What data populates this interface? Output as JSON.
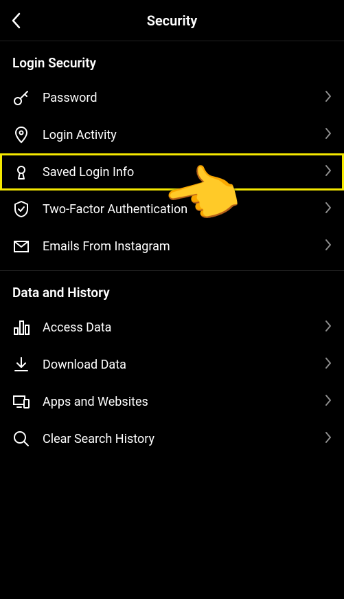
{
  "header": {
    "title": "Security"
  },
  "sections": {
    "login_security": {
      "title": "Login Security",
      "items": [
        {
          "label": "Password"
        },
        {
          "label": "Login Activity"
        },
        {
          "label": "Saved Login Info"
        },
        {
          "label": "Two-Factor Authentication"
        },
        {
          "label": "Emails From Instagram"
        }
      ]
    },
    "data_history": {
      "title": "Data and History",
      "items": [
        {
          "label": "Access Data"
        },
        {
          "label": "Download Data"
        },
        {
          "label": "Apps and Websites"
        },
        {
          "label": "Clear Search History"
        }
      ]
    }
  },
  "annotation": {
    "highlighted_item": "saved-login-info",
    "pointer_emoji": "👉"
  }
}
